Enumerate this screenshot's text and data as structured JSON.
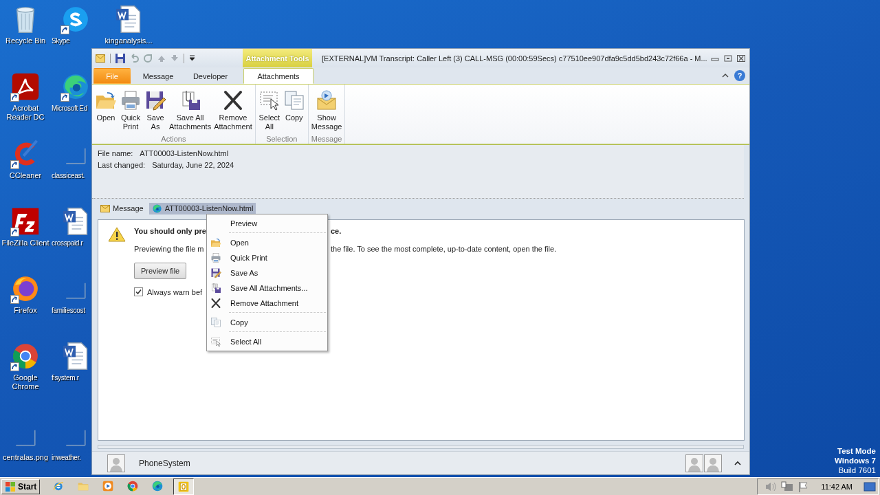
{
  "desktop": {
    "icons": [
      {
        "label": "Recycle Bin",
        "shortcut": false
      },
      {
        "label": "Skype",
        "shortcut": true
      },
      {
        "label": "kinganalysis...",
        "shortcut": false
      },
      {
        "label": "Acrobat Reader DC",
        "shortcut": true
      },
      {
        "label": "Microsoft Ed",
        "shortcut": true
      },
      {
        "label": "CCleaner",
        "shortcut": true
      },
      {
        "label": "classiceast.",
        "shortcut": false
      },
      {
        "label": "FileZilla Client",
        "shortcut": true
      },
      {
        "label": "crosspaid.r",
        "shortcut": false
      },
      {
        "label": "Firefox",
        "shortcut": true
      },
      {
        "label": "familiescost",
        "shortcut": false
      },
      {
        "label": "Google Chrome",
        "shortcut": true
      },
      {
        "label": "fisystem.r",
        "shortcut": false
      },
      {
        "label": "centralas.png",
        "shortcut": false
      },
      {
        "label": "inweather.",
        "shortcut": false
      }
    ],
    "system_notice": [
      "Test Mode",
      "Windows 7",
      "Build 7601"
    ]
  },
  "window": {
    "contextual_tab": "Attachment Tools",
    "title": "[EXTERNAL]VM Transcript: Caller Left (3) CALL-MSG (00:00:59Secs) c77510ee907dfa9c5dd5bd243c72f66a  -  M...",
    "tabs": [
      {
        "label": "File",
        "kind": "file",
        "selected": false
      },
      {
        "label": "Message",
        "kind": "tab",
        "selected": false
      },
      {
        "label": "Developer",
        "kind": "tab",
        "selected": false
      },
      {
        "label": "Attachments",
        "kind": "tab",
        "selected": true
      }
    ],
    "help": "?",
    "ribbon": [
      {
        "label": "Actions",
        "buttons": [
          {
            "lines": [
              "Open"
            ]
          },
          {
            "lines": [
              "Quick",
              "Print"
            ]
          },
          {
            "lines": [
              "Save",
              "As"
            ]
          },
          {
            "lines": [
              "Save All",
              "Attachments"
            ]
          },
          {
            "lines": [
              "Remove",
              "Attachment"
            ]
          }
        ]
      },
      {
        "label": "Selection",
        "buttons": [
          {
            "lines": [
              "Select",
              "All"
            ]
          },
          {
            "lines": [
              "Copy"
            ]
          }
        ]
      },
      {
        "label": "Message",
        "buttons": [
          {
            "lines": [
              "Show",
              "Message"
            ]
          }
        ]
      }
    ],
    "info": [
      {
        "label": "File name:",
        "value": "ATT00003-ListenNow.html"
      },
      {
        "label": "Last changed:",
        "value": "Saturday, June 22, 2024"
      }
    ],
    "attachment_tabs": [
      {
        "label": "Message",
        "selected": false
      },
      {
        "label": "ATT00003-ListenNow.html",
        "selected": true
      }
    ],
    "preview": {
      "warning": [
        "You should only pre",
        "ce."
      ],
      "message": [
        "Previewing the file m",
        "the file. To see the most complete, up-to-date content, open the file."
      ],
      "button": "Preview file",
      "checkbox": {
        "label": "Always warn bef",
        "checked": true
      }
    },
    "people_pane": {
      "name": "PhoneSystem"
    }
  },
  "context_menu": [
    {
      "kind": "command",
      "label": "Preview"
    },
    {
      "kind": "separator"
    },
    {
      "kind": "command",
      "label": "Open"
    },
    {
      "kind": "command",
      "label": "Quick Print"
    },
    {
      "kind": "command",
      "label": "Save As"
    },
    {
      "kind": "command",
      "label": "Save All Attachments..."
    },
    {
      "kind": "command",
      "label": "Remove Attachment"
    },
    {
      "kind": "separator"
    },
    {
      "kind": "command",
      "label": "Copy"
    },
    {
      "kind": "separator"
    },
    {
      "kind": "command",
      "label": "Select All"
    }
  ],
  "taskbar": {
    "start": "Start",
    "apps": [
      {
        "selected": false
      },
      {
        "selected": false
      },
      {
        "selected": false
      },
      {
        "selected": false
      },
      {
        "selected": false
      },
      {
        "selected": true
      }
    ],
    "time": "11:42 AM"
  }
}
